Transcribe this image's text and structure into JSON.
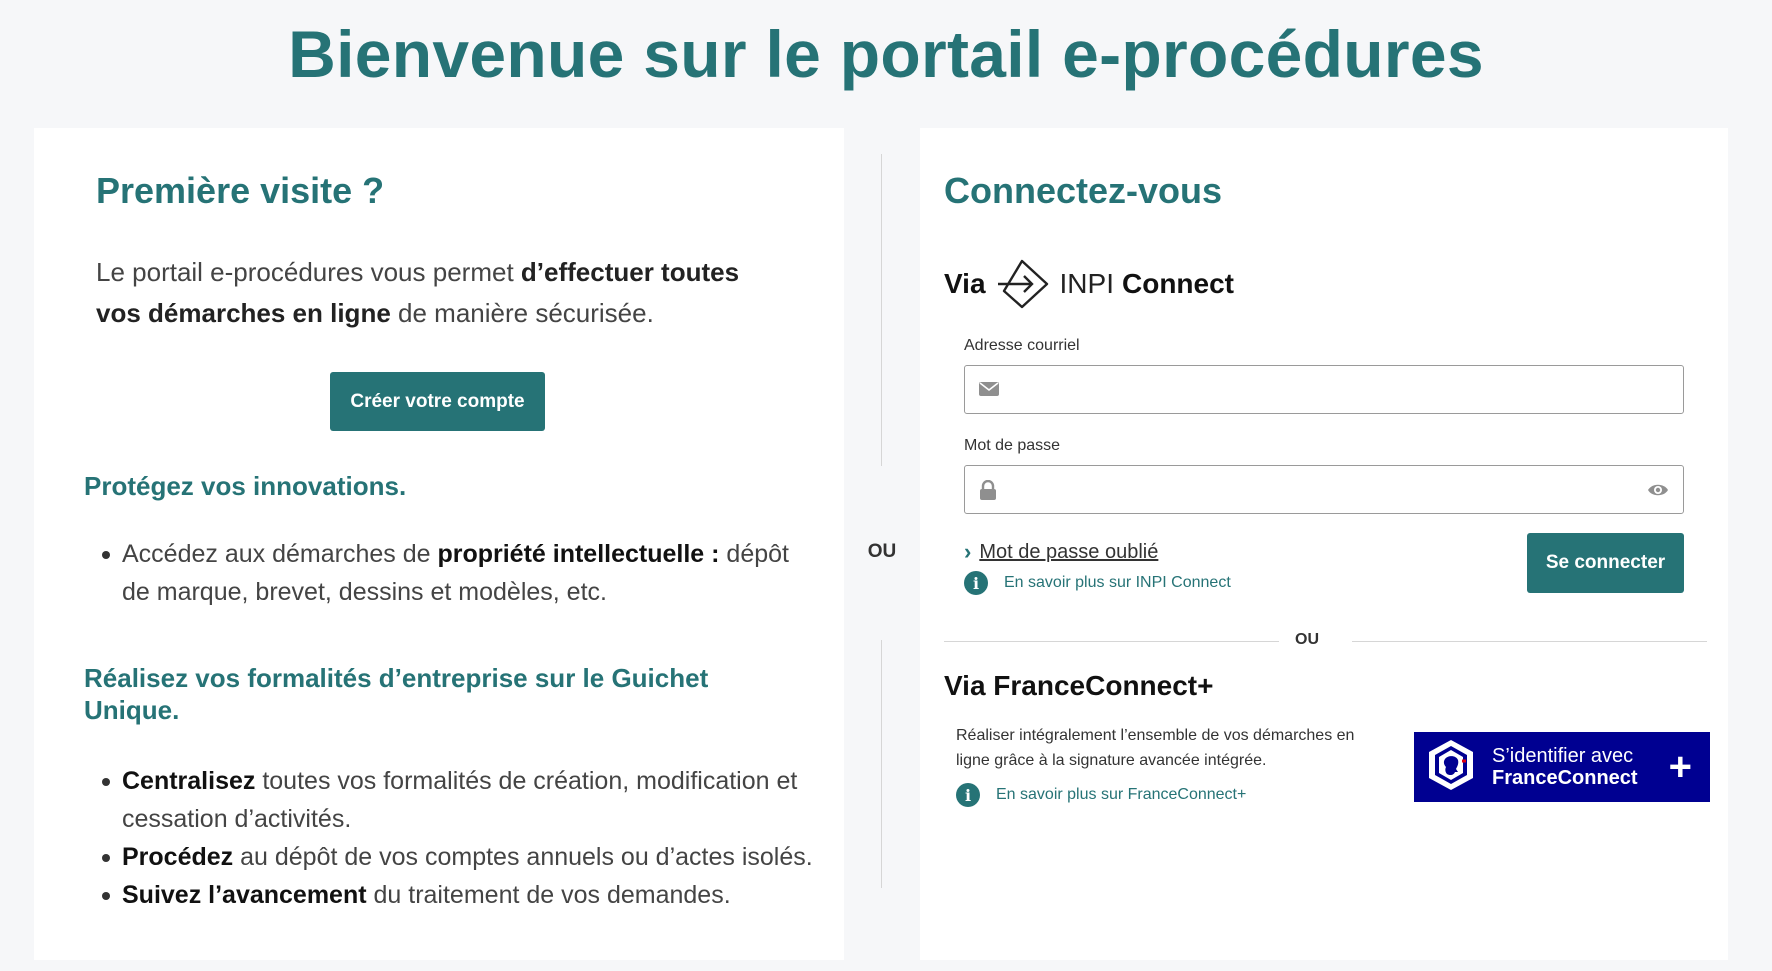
{
  "header": {
    "title": "Bienvenue sur le portail e-procédures"
  },
  "left": {
    "title": "Première visite ?",
    "intro": {
      "part1": "Le portail e-procédures vous permet ",
      "bold1": "d’effectuer toutes vos démarches en ligne",
      "part2": " de manière sécurisée."
    },
    "create_button": "Créer votre compte",
    "section1": {
      "title": "Protégez vos innovations.",
      "items": [
        {
          "pre": "Accédez aux démarches de ",
          "bold": "propriété intellectuelle :",
          "post": " dépôt de marque, brevet, dessins et modèles, etc."
        }
      ]
    },
    "section2": {
      "title": "Réalisez vos formalités d’entreprise sur le Guichet Unique.",
      "items": [
        {
          "bold": "Centralisez",
          "post": " toutes vos formalités de création, modification et cessation d’activités."
        },
        {
          "bold": "Procédez",
          "post": " au dépôt de vos comptes annuels ou d’actes isolés."
        },
        {
          "bold": "Suivez l’avancement",
          "post": " du traitement de vos demandes."
        }
      ]
    }
  },
  "divider_label": "OU",
  "right": {
    "title": "Connectez-vous",
    "via_label": "Via",
    "inpi_brand": "INPI",
    "inpi_connect": "Connect",
    "email_label": "Adresse courriel",
    "email_value": "",
    "password_label": "Mot de passe",
    "password_value": "",
    "forgot_link": "Mot de passe oublié",
    "info_inpi": "En savoir plus sur INPI Connect",
    "login_button": "Se connecter",
    "or_label": "OU",
    "fc_title": "Via FranceConnect+",
    "fc_description": "Réaliser intégralement l’ensemble de vos démarches en ligne grâce à la signature avancée intégrée.",
    "info_fc": "En savoir plus sur FranceConnect+",
    "fc_button_line1": "S’identifier avec",
    "fc_button_line2": "FranceConnect",
    "fc_button_plus": "+"
  },
  "colors": {
    "primary": "#267376",
    "france_connect_blue": "#000091",
    "background": "#f6f7f9"
  },
  "icons": [
    "envelope-icon",
    "lock-icon",
    "eye-icon",
    "chevron-right-icon",
    "info-icon",
    "inpi-connect-logo",
    "franceconnect-logo"
  ]
}
